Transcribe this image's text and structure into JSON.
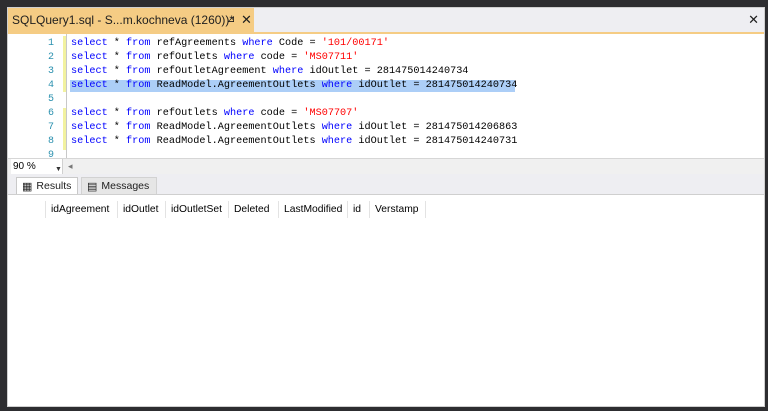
{
  "tab": {
    "title": "SQLQuery1.sql - S...m.kochneva (1260))*",
    "pin_icon": "pin-icon",
    "close_glyph": "✕"
  },
  "window": {
    "close_glyph": "✕"
  },
  "editor": {
    "line_numbers": [
      "1",
      "2",
      "3",
      "4",
      "5",
      "6",
      "7",
      "8",
      "9"
    ],
    "lines": [
      {
        "kw1": "select",
        "mid1": " * ",
        "kw2": "from",
        "obj": " refAgreements ",
        "kw3": "where",
        "cond": " Code = ",
        "str": "'101/00171'",
        "tail": ""
      },
      {
        "kw1": "select",
        "mid1": " * ",
        "kw2": "from",
        "obj": " refOutlets ",
        "kw3": "where",
        "cond": " code = ",
        "str": "'MS07711'",
        "tail": ""
      },
      {
        "kw1": "select",
        "mid1": " * ",
        "kw2": "from",
        "obj": " refOutletAgreement ",
        "kw3": "where",
        "cond": " idOutlet = 281475014240734",
        "str": "",
        "tail": ""
      },
      {
        "kw1": "select",
        "mid1": " * ",
        "kw2": "from",
        "obj": " ReadModel.AgreementOutlets ",
        "kw3": "where",
        "cond": " idOutlet = 281475014240734",
        "str": "",
        "tail": ""
      },
      {
        "kw1": "select",
        "mid1": " * ",
        "kw2": "from",
        "obj": " refOutlets ",
        "kw3": "where",
        "cond": " code = ",
        "str": "'MS07707'",
        "tail": ""
      },
      {
        "kw1": "select",
        "mid1": " * ",
        "kw2": "from",
        "obj": " ReadModel.AgreementOutlets ",
        "kw3": "where",
        "cond": " idOutlet = 281475014206863",
        "str": "",
        "tail": ""
      },
      {
        "kw1": "select",
        "mid1": " * ",
        "kw2": "from",
        "obj": " ReadModel.AgreementOutlets ",
        "kw3": "where",
        "cond": " idOutlet = 281475014240731",
        "str": "",
        "tail": ""
      }
    ]
  },
  "zoom": {
    "value": "90 %"
  },
  "results_tabs": [
    {
      "label": "Results",
      "icon": "grid-icon"
    },
    {
      "label": "Messages",
      "icon": "messages-icon"
    }
  ],
  "grid": {
    "columns": [
      "idAgreement",
      "idOutlet",
      "idOutletSet",
      "Deleted",
      "LastModified",
      "id",
      "Verstamp"
    ]
  },
  "colors": {
    "keyword": "#0000ff",
    "string": "#ff0000",
    "line_number": "#2b91af",
    "selection": "#accef7",
    "active_tab": "#f5cc84"
  }
}
